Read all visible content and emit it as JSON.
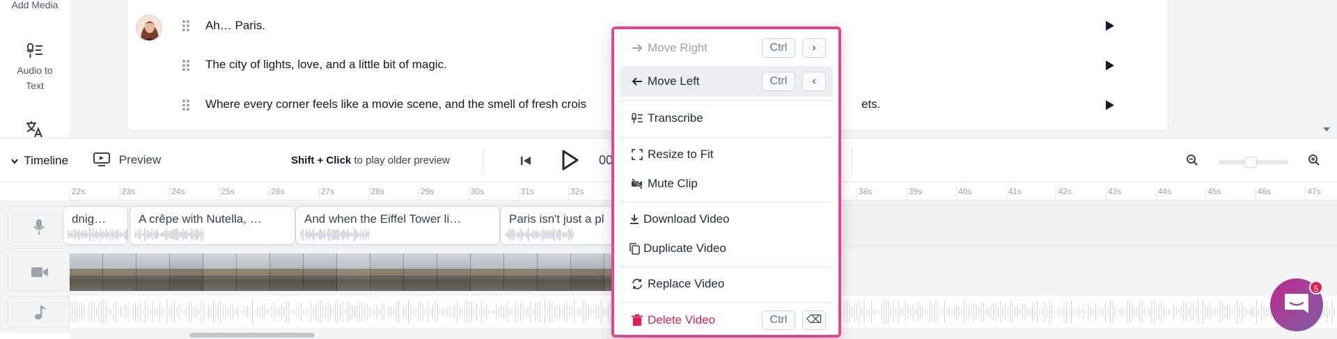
{
  "sidebar": {
    "items": [
      {
        "label": "Add Media",
        "icon": "add-media-icon"
      },
      {
        "label": "Audio to Text",
        "icon": "audio-to-text-icon"
      },
      {
        "label": "",
        "icon": "translate-icon"
      }
    ]
  },
  "script": {
    "rows": [
      {
        "text": "Ah… Paris.",
        "has_avatar": true
      },
      {
        "text": "The city of lights, love, and a little bit of magic.",
        "has_avatar": false
      },
      {
        "text": "Where every corner feels like a movie scene, and the smell of fresh crois",
        "trailing_text": "ets.",
        "has_avatar": false
      }
    ]
  },
  "timeline_header": {
    "timeline_label": "Timeline",
    "preview_label": "Preview",
    "hint_bold": "Shift + Click",
    "hint_rest": " to play older preview",
    "time_readout": "00",
    "zoom_level": 0.45
  },
  "ruler": {
    "left_ticks": [
      "22s",
      "23s",
      "24s",
      "25s",
      "26s",
      "27s",
      "28s",
      "29s",
      "30s",
      "31s",
      "32s"
    ],
    "right_ticks": [
      "38s",
      "39s",
      "40s",
      "41s",
      "42s",
      "43s",
      "44s",
      "45s",
      "46s",
      "47s"
    ]
  },
  "subtitle_clips": [
    {
      "text": "dnig…"
    },
    {
      "text": "A crêpe with Nutella, …"
    },
    {
      "text": "And when the Eiffel Tower li…"
    },
    {
      "text": "Paris isn't just a pl"
    }
  ],
  "context_menu": {
    "items": [
      {
        "label": "Move Right",
        "icon": "arrow-right-icon",
        "shortcut_mod": "Ctrl",
        "shortcut_key": "›",
        "state": "disabled"
      },
      {
        "label": "Move Left",
        "icon": "arrow-left-icon",
        "shortcut_mod": "Ctrl",
        "shortcut_key": "‹",
        "state": "active"
      },
      {
        "label": "Transcribe",
        "icon": "transcribe-icon"
      },
      {
        "label": "Resize to Fit",
        "icon": "resize-icon"
      },
      {
        "label": "Mute Clip",
        "icon": "mute-icon"
      },
      {
        "label": "Download Video",
        "icon": "download-icon"
      },
      {
        "label": "Duplicate Video",
        "icon": "duplicate-icon"
      },
      {
        "label": "Replace Video",
        "icon": "replace-icon"
      },
      {
        "label": "Delete Video",
        "icon": "trash-icon",
        "shortcut_mod": "Ctrl",
        "shortcut_key": "⌫",
        "state": "danger"
      }
    ],
    "border_color": "#e8458f"
  },
  "chat": {
    "badge_count": "5"
  },
  "colors": {
    "accent": "#e8458f",
    "danger": "#e11d48",
    "chat_gradient_start": "#c0268f",
    "chat_gradient_end": "#7c5aa6"
  }
}
